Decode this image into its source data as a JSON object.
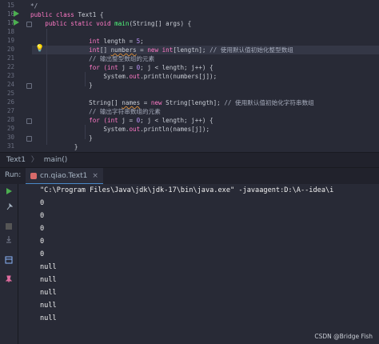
{
  "editor": {
    "line_numbers": [
      "15",
      "16",
      "17",
      "18",
      "19",
      "20",
      "21",
      "22",
      "23",
      "24",
      "25",
      "26",
      "27",
      "28",
      "29",
      "30",
      "31"
    ],
    "lines": {
      "l15": "*/",
      "l16a": "public class ",
      "l16b": "Text1",
      "l16c": " {",
      "l17a": "    public static void ",
      "l17b": "main",
      "l17c": "(String[] args) {",
      "l19a": "                int ",
      "l19b": "length = ",
      "l19c": "5",
      "l19d": ";",
      "l20a": "                int",
      "l20b": "[] ",
      "l20c": "numbers",
      "l20d": " = ",
      "l20e": "new int",
      "l20f": "[lengtn]; ",
      "l20g": "// 使用默认值初始化整型数组",
      "l21": "                // 输出整型数组的元素",
      "l22a": "                for ",
      "l22b": "(int ",
      "l22c": "j = ",
      "l22d": "0",
      "l22e": "; j < length; j++) {",
      "l23a": "                    System.",
      "l23b": "out",
      "l23c": ".println(numbers[j]);",
      "l24": "                }",
      "l25a": "                String[] ",
      "l25b": "names",
      "l25c": " = ",
      "l25d": "new ",
      "l25e": "String[length]; ",
      "l25f": "// 使用默认值初始化字符串数组",
      "l26": "                // 输出字符串数组的元素",
      "l27a": "                for ",
      "l27b": "(int ",
      "l27c": "j = ",
      "l27d": "0",
      "l27e": "; j < length; j++) {",
      "l28a": "                    System.",
      "l28b": "out",
      "l28c": ".println(names[j]);",
      "l29": "                }",
      "l30": "            }"
    }
  },
  "breadcrumb": {
    "class": "Text1",
    "sep": "〉",
    "method": "main()"
  },
  "runbar": {
    "label": "Run:",
    "tab": "cn.qiao.Text1",
    "close": "×"
  },
  "console": {
    "command": "\"C:\\Program Files\\Java\\jdk\\jdk-17\\bin\\java.exe\" -javaagent:D:\\A--idea\\i",
    "output": [
      "0",
      "0",
      "0",
      "0",
      "0",
      "null",
      "null",
      "null",
      "null",
      "null"
    ]
  },
  "watermark": "CSDN @Bridge Fish",
  "colors": {
    "keyword": "#ff79c6",
    "type": "#8be9fd",
    "comment": "#a7adbd",
    "number": "#bd93f9",
    "function": "#50fa7b",
    "run_green": "#4caf50"
  }
}
